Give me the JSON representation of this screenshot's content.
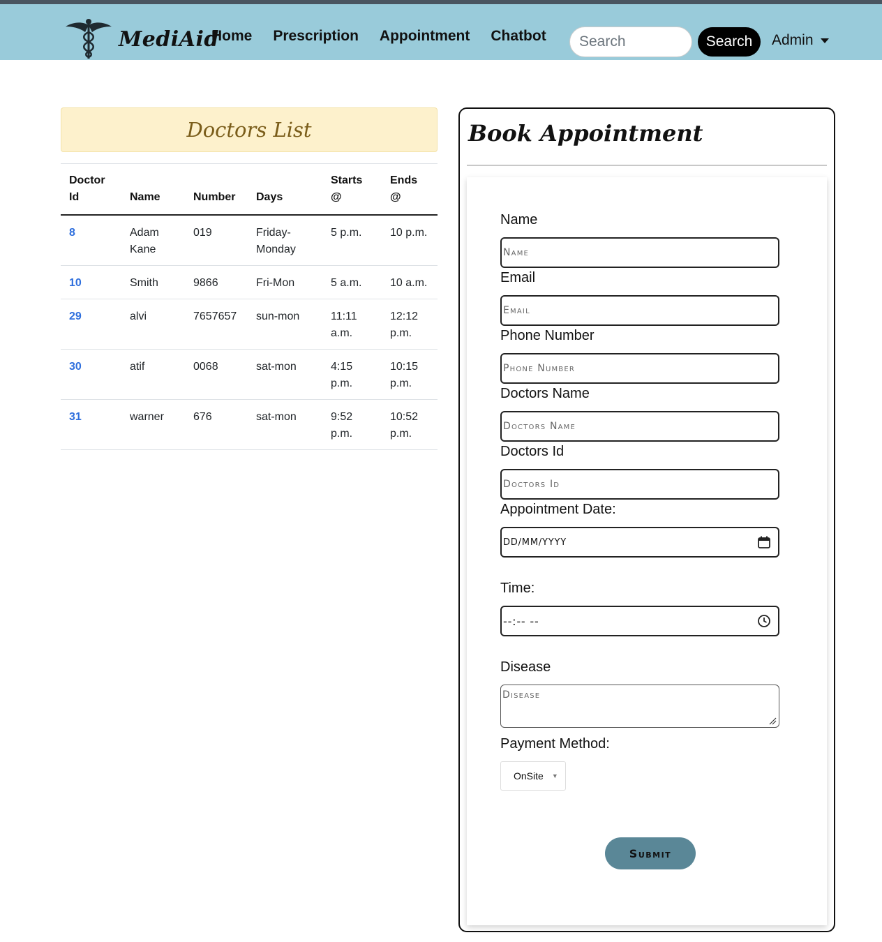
{
  "navbar": {
    "brand": "MediAid",
    "links": [
      "Home",
      "Prescription",
      "Appointment",
      "Chatbot"
    ],
    "search_placeholder": "Search",
    "search_button": "Search",
    "user_menu": "Admin"
  },
  "doctors": {
    "title": "Doctors List",
    "columns": [
      "Doctor Id",
      "Name",
      "Number",
      "Days",
      "Starts @",
      "Ends @"
    ],
    "rows": [
      {
        "id": "8",
        "name": "Adam Kane",
        "number": "019",
        "days": "Friday-Monday",
        "starts": "5 p.m.",
        "ends": "10 p.m."
      },
      {
        "id": "10",
        "name": "Smith",
        "number": "9866",
        "days": "Fri-Mon",
        "starts": "5 a.m.",
        "ends": "10 a.m."
      },
      {
        "id": "29",
        "name": "alvi",
        "number": "7657657",
        "days": "sun-mon",
        "starts": "11:11 a.m.",
        "ends": "12:12 p.m."
      },
      {
        "id": "30",
        "name": "atif",
        "number": "0068",
        "days": "sat-mon",
        "starts": "4:15 p.m.",
        "ends": "10:15 p.m."
      },
      {
        "id": "31",
        "name": "warner",
        "number": "676",
        "days": "sat-mon",
        "starts": "9:52 p.m.",
        "ends": "10:52 p.m."
      }
    ]
  },
  "booking": {
    "title": "Book Appointment",
    "name_label": "Name",
    "name_placeholder": "Name",
    "email_label": "Email",
    "email_placeholder": "Email",
    "phone_label": "Phone Number",
    "phone_placeholder": "Phone Number",
    "doctor_name_label": "Doctors Name",
    "doctor_name_placeholder": "Doctors Name",
    "doctor_id_label": "Doctors Id",
    "doctor_id_placeholder": "Doctors Id",
    "date_label": "Appointment Date:",
    "date_placeholder": "DD/MM/YYYY",
    "time_label": "Time:",
    "time_placeholder": "--:-- --",
    "disease_label": "Disease",
    "disease_placeholder": "Disease",
    "payment_label": "Payment Method:",
    "payment_selected": "OnSite",
    "submit": "Submit"
  },
  "colors": {
    "navbar_bg": "#99cbda",
    "doctors_header_bg": "#fdf1cc",
    "doctor_id_link": "#2f6fdd",
    "submit_bg": "#5a8797"
  },
  "icons": [
    "caduceus-logo-icon",
    "calendar-icon",
    "clock-icon",
    "chevron-down-icon",
    "resize-grip-icon"
  ]
}
